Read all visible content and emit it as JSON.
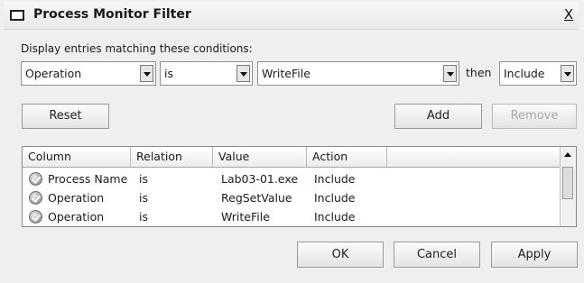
{
  "window": {
    "title": "Process Monitor Filter",
    "close_label": "X"
  },
  "prompt": "Display entries matching these conditions:",
  "condition": {
    "column": "Operation",
    "relation": "is",
    "value": "WriteFile",
    "then_label": "then",
    "action": "Include"
  },
  "buttons": {
    "reset": "Reset",
    "add": "Add",
    "remove": "Remove",
    "ok": "OK",
    "cancel": "Cancel",
    "apply": "Apply"
  },
  "table": {
    "headers": [
      "Column",
      "Relation",
      "Value",
      "Action"
    ],
    "rows": [
      {
        "column": "Process Name",
        "relation": "is",
        "value": "Lab03-01.exe",
        "action": "Include"
      },
      {
        "column": "Operation",
        "relation": "is",
        "value": "RegSetValue",
        "action": "Include"
      },
      {
        "column": "Operation",
        "relation": "is",
        "value": "WriteFile",
        "action": "Include"
      }
    ]
  }
}
